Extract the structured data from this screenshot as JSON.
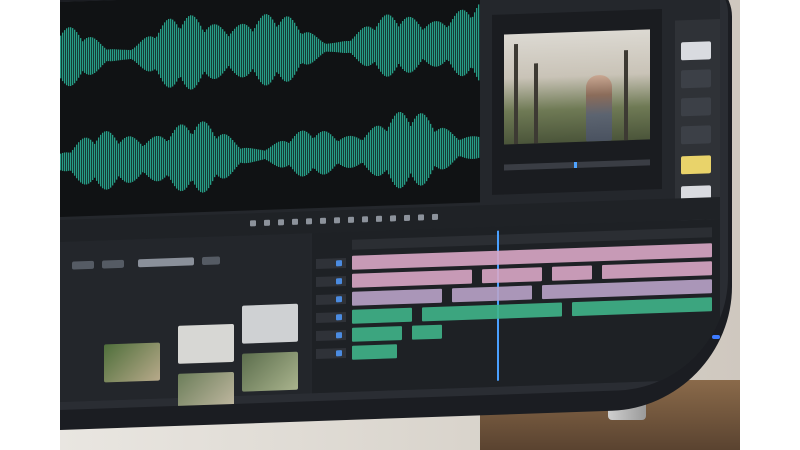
{
  "scene": {
    "description_colors": {
      "waveform": "#2bb69a",
      "waveform_dark": "#0f1a18",
      "ui_background": "#24272c",
      "audio_clip": "#3fb48a",
      "video_clip": "#d9a7c7",
      "playhead": "#4aa0ff"
    }
  },
  "icons": {
    "monitor": "monitor-icon",
    "speaker": "speaker-icon"
  }
}
